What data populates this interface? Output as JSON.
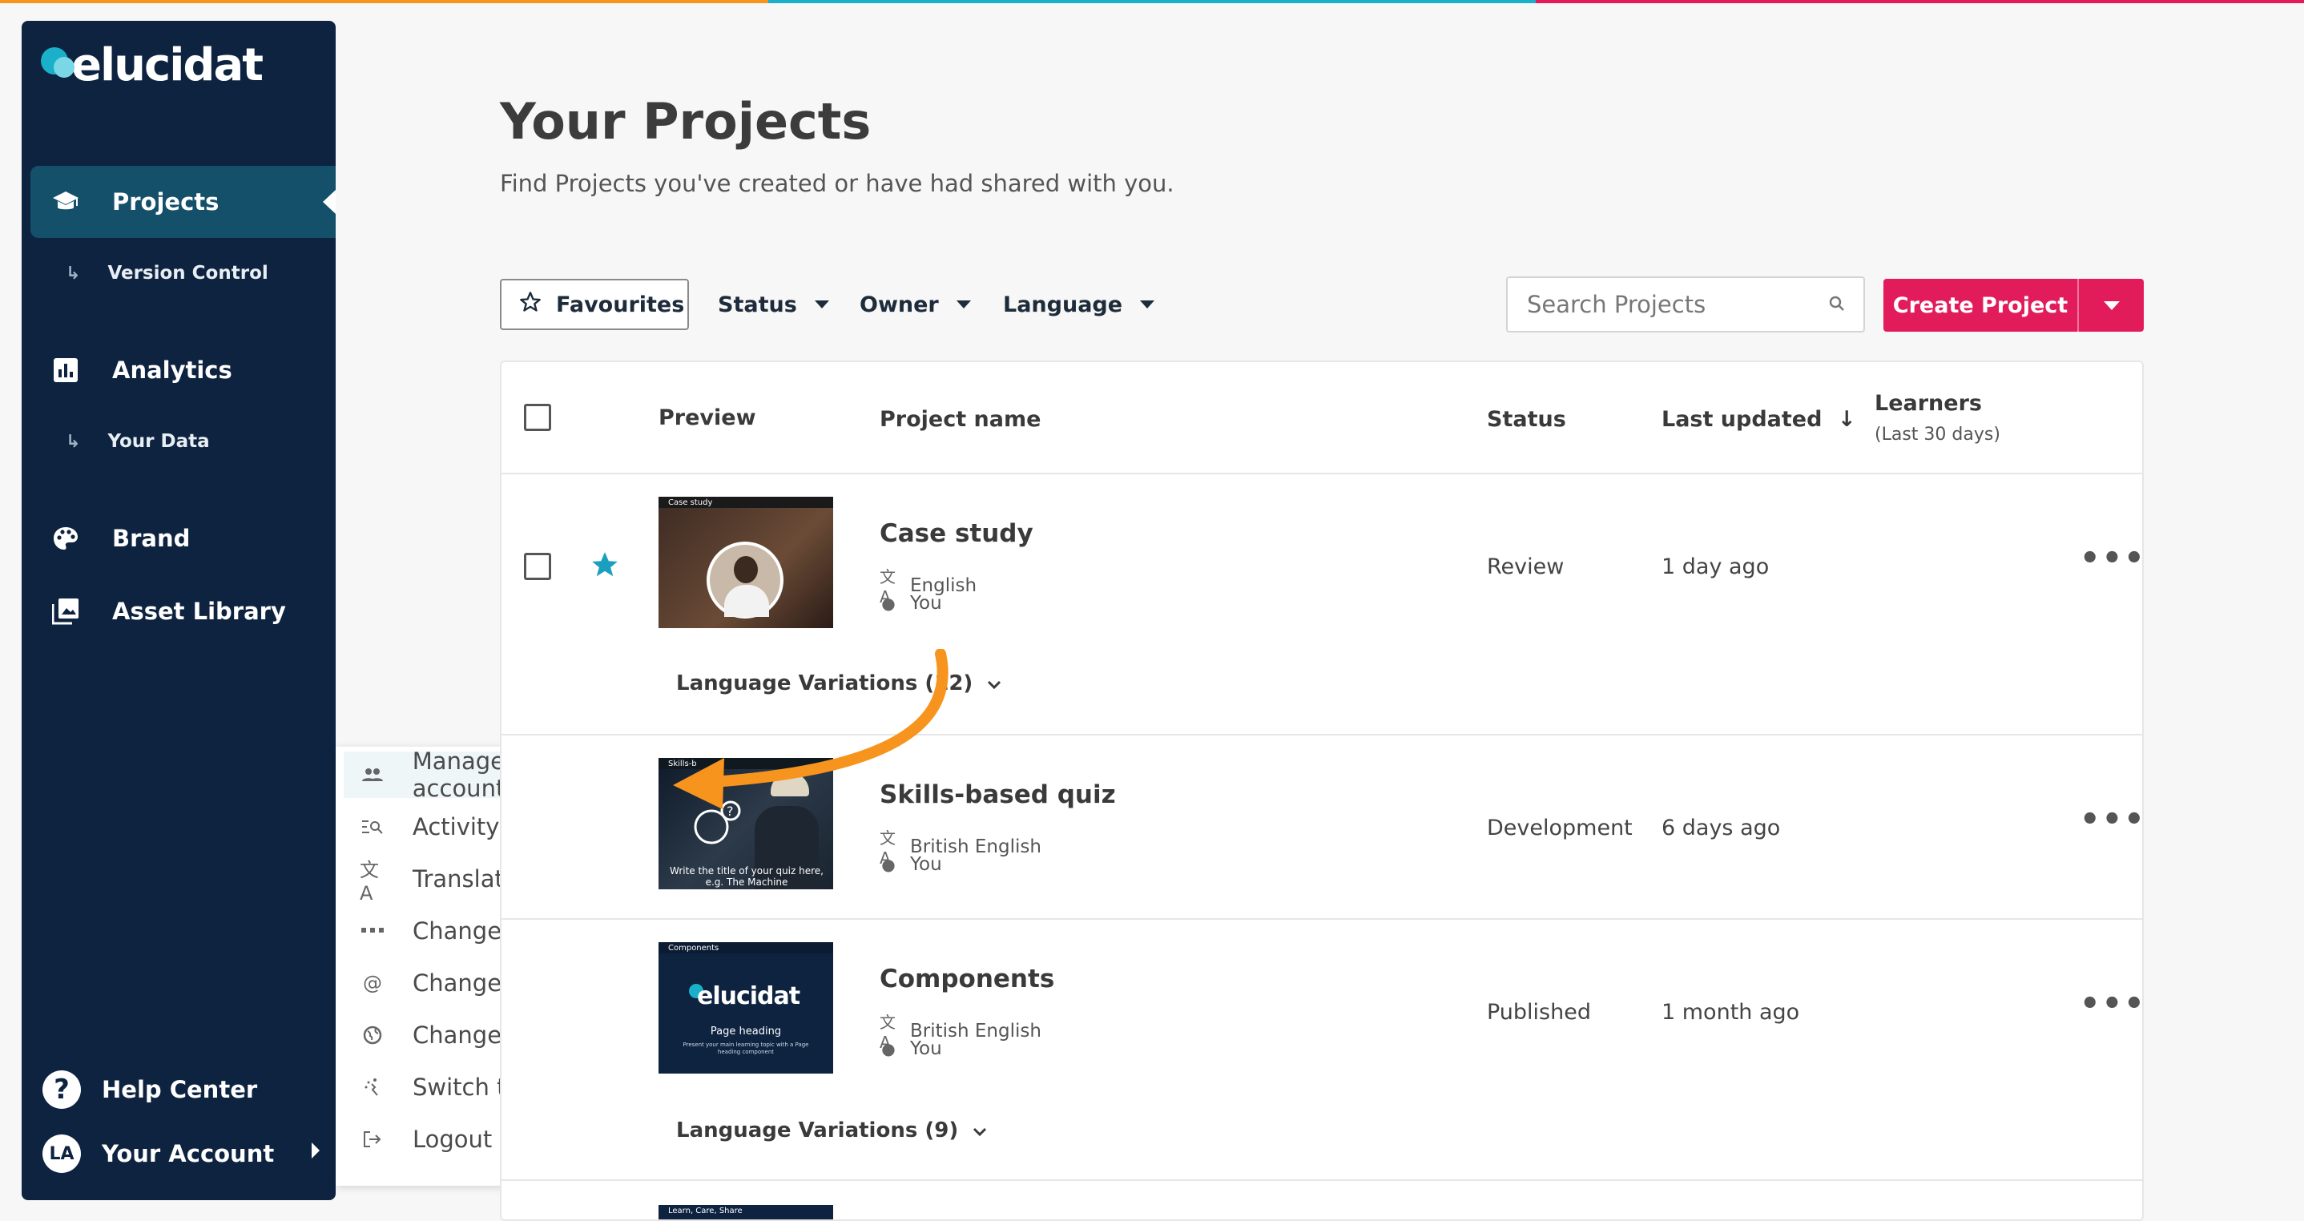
{
  "colors": {
    "sidebar_bg": "#0d2340",
    "active_nav": "#14506a",
    "brand_accent": "#e21b5a",
    "star": "#1a9fc0",
    "arrow": "#f7941d",
    "topbar": [
      "#f7941d",
      "#1ab0c9",
      "#e21b5a"
    ]
  },
  "sidebar": {
    "logo_text": "elucidat",
    "items": [
      {
        "label": "Projects",
        "icon": "graduation-cap-icon",
        "active": true
      },
      {
        "label": "Analytics",
        "icon": "bar-chart-icon"
      },
      {
        "label": "Brand",
        "icon": "palette-icon"
      },
      {
        "label": "Asset Library",
        "icon": "image-library-icon"
      }
    ],
    "subitems": {
      "version_control": "Version Control",
      "your_data": "Your Data"
    },
    "help_label": "Help Center",
    "account_initials": "LA",
    "account_label": "Your Account"
  },
  "account_menu": {
    "items": [
      {
        "label": "Manage your account",
        "icon": "people-icon"
      },
      {
        "label": "Activity",
        "icon": "activity-search-icon"
      },
      {
        "label": "Translation glossary",
        "icon": "translate-icon"
      },
      {
        "label": "Change password",
        "icon": "password-dots-icon"
      },
      {
        "label": "Change email",
        "icon": "at-sign-icon"
      },
      {
        "label": "Change Language",
        "icon": "globe-icon"
      },
      {
        "label": "Switch to Author",
        "icon": "switch-icon"
      },
      {
        "label": "Logout",
        "icon": "logout-icon"
      }
    ]
  },
  "main": {
    "title": "Your Projects",
    "subtitle": "Find Projects you've created or have had shared with you.",
    "filters": {
      "favourites": "Favourites",
      "status": "Status",
      "owner": "Owner",
      "language": "Language"
    },
    "search_placeholder": "Search Projects",
    "create_label": "Create Project"
  },
  "table": {
    "headers": {
      "preview": "Preview",
      "project_name": "Project name",
      "status": "Status",
      "last_updated": "Last updated",
      "learners": "Learners",
      "learners_sub": "(Last 30 days)"
    },
    "rows": [
      {
        "name": "Case study",
        "language": "English",
        "owner": "You",
        "status": "Review",
        "updated": "1 day ago",
        "favourite": true,
        "thumb_title": "Case study",
        "variations": "Language Variations (12)"
      },
      {
        "name": "Skills-based quiz",
        "language": "British English",
        "owner": "You",
        "status": "Development",
        "updated": "6 days ago",
        "favourite": false,
        "thumb_title": "Skills-b",
        "thumb_caption": "Write the title of your quiz here, e.g. The Machine"
      },
      {
        "name": "Components",
        "language": "British English",
        "owner": "You",
        "status": "Published",
        "updated": "1 month ago",
        "favourite": false,
        "thumb_title": "Components",
        "thumb_logo": "elucidat",
        "thumb_heading": "Page heading",
        "thumb_body": "Present your main learning topic with a Page heading component",
        "variations": "Language Variations (9)"
      },
      {
        "thumb_title": "Learn, Care, Share"
      }
    ]
  }
}
